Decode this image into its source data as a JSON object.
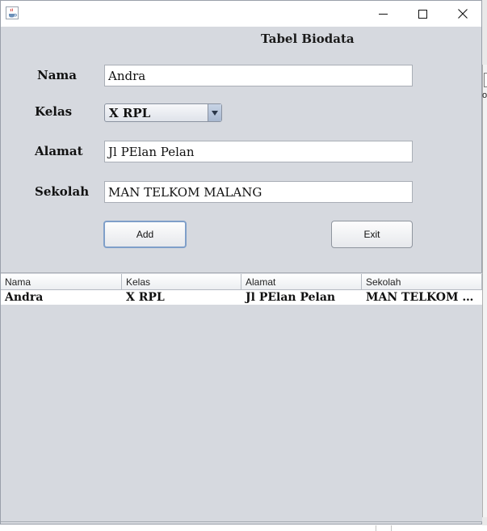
{
  "window": {
    "icon": "java-cup-icon",
    "controls": {
      "minimize": "minimize-icon",
      "maximize": "maximize-icon",
      "close": "close-icon"
    }
  },
  "heading": "Tabel Biodata",
  "form": {
    "nama": {
      "label": "Nama",
      "value": "Andra"
    },
    "kelas": {
      "label": "Kelas",
      "value": "X RPL"
    },
    "alamat": {
      "label": "Alamat",
      "value": "Jl PElan Pelan"
    },
    "sekolah": {
      "label": "Sekolah",
      "value": "MAN TELKOM MALANG"
    }
  },
  "buttons": {
    "add": "Add",
    "exit": "Exit"
  },
  "table": {
    "columns": [
      "Nama",
      "Kelas",
      "Alamat",
      "Sekolah"
    ],
    "rows": [
      [
        "Andra",
        "X RPL",
        "Jl PElan Pelan",
        "MAN TELKOM MALANG"
      ]
    ]
  },
  "background_app": {
    "visible_letter": "o"
  },
  "colors": {
    "window_bg": "#d6d9df",
    "focus_border": "#7f9fc9"
  }
}
